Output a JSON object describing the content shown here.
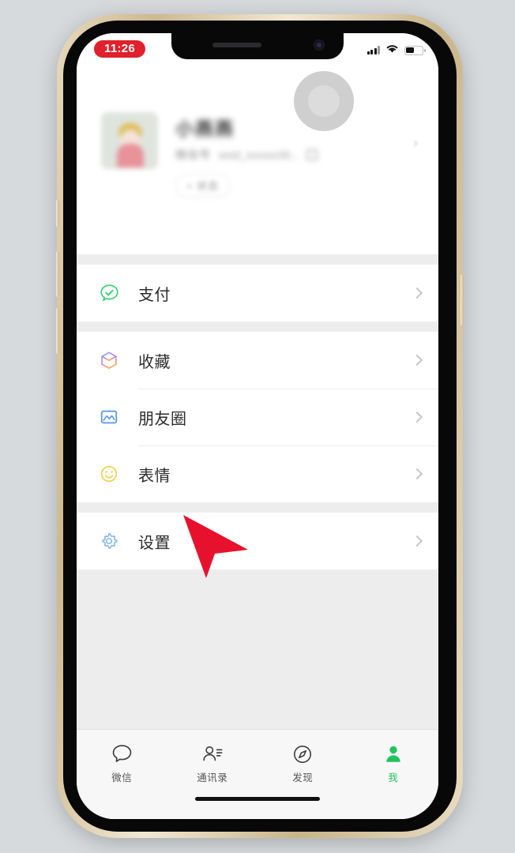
{
  "status_bar": {
    "time": "11:26",
    "signal_icon": "cellular-signal-icon",
    "wifi_icon": "wifi-icon",
    "battery_icon": "battery-icon"
  },
  "profile": {
    "avatar_icon": "user-avatar",
    "name": "小燕燕",
    "wechat_id_label": "微信号",
    "wechat_id_value": "wxid_xxxxxx39...",
    "qr_icon": "qr-code-icon",
    "chevron_icon": "chevron-right-icon",
    "status_button_label": "+ 状态"
  },
  "menu": {
    "groups": [
      {
        "items": [
          {
            "label": "支付",
            "icon": "wechat-pay-icon",
            "color": "#3ccf76",
            "chevron": "chevron-right-icon"
          }
        ]
      },
      {
        "items": [
          {
            "label": "收藏",
            "icon": "favorites-cube-icon",
            "color": "#6aa9f0",
            "chevron": "chevron-right-icon"
          },
          {
            "label": "朋友圈",
            "icon": "moments-photo-icon",
            "color": "#5596e6",
            "chevron": "chevron-right-icon"
          },
          {
            "label": "表情",
            "icon": "stickers-smiley-icon",
            "color": "#f2d24f",
            "chevron": "chevron-right-icon"
          }
        ]
      },
      {
        "items": [
          {
            "label": "设置",
            "icon": "settings-gear-icon",
            "color": "#86b9e6",
            "chevron": "chevron-right-icon"
          }
        ]
      }
    ]
  },
  "tabbar": {
    "tabs": [
      {
        "label": "微信",
        "icon": "chat-bubble-icon",
        "active": false
      },
      {
        "label": "通讯录",
        "icon": "contacts-icon",
        "active": false
      },
      {
        "label": "发现",
        "icon": "compass-icon",
        "active": false
      },
      {
        "label": "我",
        "icon": "person-icon",
        "active": true
      }
    ],
    "active_color": "#22c35e",
    "inactive_color": "#555555"
  },
  "cursor": {
    "icon": "mouse-pointer-arrow",
    "color": "#e8112d"
  },
  "device": {
    "frame_color": "#d9c49a",
    "home_indicator": "home-indicator-bar"
  }
}
